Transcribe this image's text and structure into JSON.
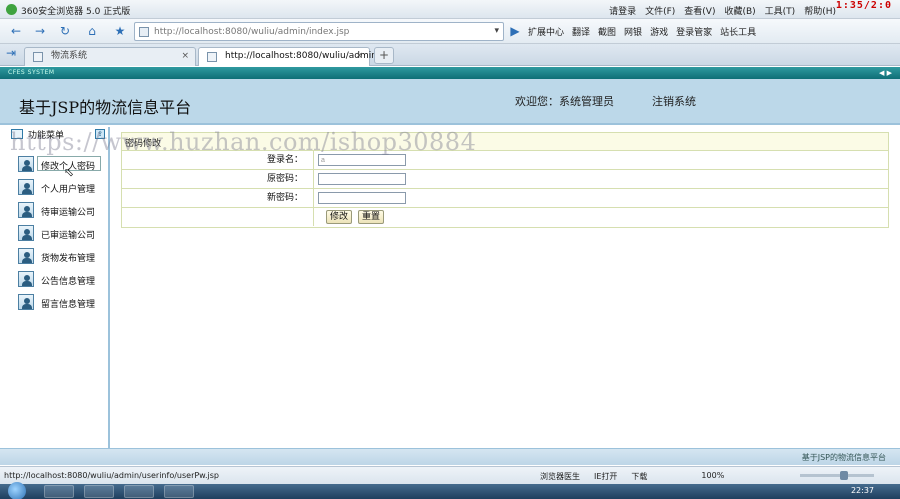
{
  "browser": {
    "title": "360安全浏览器 5.0 正式版",
    "menu": [
      "请登录",
      "文件(F)",
      "查看(V)",
      "收藏(B)",
      "工具(T)",
      "帮助(H)"
    ],
    "window_controls": "1:35/2:0",
    "url": "http://localhost:8080/wuliu/admin/index.jsp",
    "toolbar": [
      "扩展中心",
      "翻译",
      "截图",
      "网银",
      "游戏",
      "登录管家",
      "站长工具"
    ],
    "tabs": [
      {
        "label": "物流系统",
        "active": false
      },
      {
        "label": "http://localhost:8080/wuliu/admin...",
        "active": true
      }
    ],
    "status_url": "http://localhost:8080/wuliu/admin/userinfo/userPw.jsp",
    "status_items": [
      "浏览器医生",
      "IE打开",
      "下载",
      "100%"
    ],
    "clock": "22:37"
  },
  "app": {
    "system_label": "CFES SYSTEM",
    "site_title": "基于JSP的物流信息平台",
    "welcome": "欢迎您：系统管理员",
    "logout": "注销系统",
    "sidebar": {
      "header": "功能菜单",
      "items": [
        {
          "label": "修改个人密码",
          "selected": true
        },
        {
          "label": "个人用户管理",
          "selected": false
        },
        {
          "label": "待审运输公司",
          "selected": false
        },
        {
          "label": "已审运输公司",
          "selected": false
        },
        {
          "label": "货物发布管理",
          "selected": false
        },
        {
          "label": "公告信息管理",
          "selected": false
        },
        {
          "label": "留言信息管理",
          "selected": false
        }
      ]
    },
    "form": {
      "title": "密码修改",
      "fields": [
        {
          "label": "登录名：",
          "value": "a"
        },
        {
          "label": "原密码：",
          "value": ""
        },
        {
          "label": "新密码：",
          "value": ""
        }
      ],
      "submit": "修改",
      "reset": "重置"
    },
    "footer": "基于JSP的物流信息平台"
  },
  "watermark": "https://www.huzhan.com/ishop30884"
}
